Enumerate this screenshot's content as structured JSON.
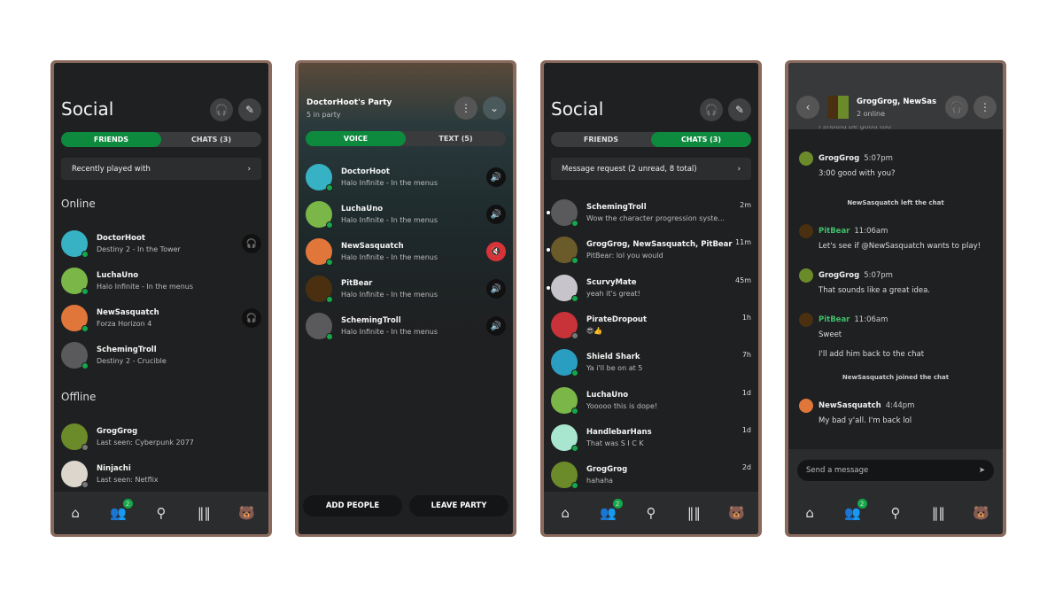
{
  "accent": "#0e8a3e",
  "online": "#14a84a",
  "muted": "#d9333a",
  "nav": {
    "icons": [
      "home-icon",
      "friends-icon",
      "search-icon",
      "library-icon",
      "profile-avatar-icon"
    ],
    "glyphs": [
      "⌂",
      "👥",
      "⚲",
      "‖‖",
      "🐻"
    ],
    "badge": "2"
  },
  "s1": {
    "title": "Social",
    "tabs": [
      "FRIENDS",
      "CHATS (3)"
    ],
    "recent": "Recently played with",
    "online_label": "Online",
    "offline_label": "Offline",
    "online": [
      {
        "name": "DoctorHoot",
        "status": "Destiny 2 - In the Tower",
        "color": "#37b2c4",
        "party": true
      },
      {
        "name": "LuchaUno",
        "status": "Halo Infinite - In the menus",
        "color": "#7ab648"
      },
      {
        "name": "NewSasquatch",
        "status": "Forza Horizon 4",
        "color": "#e0763a",
        "party": true
      },
      {
        "name": "SchemingTroll",
        "status": "Destiny 2 - Crucible",
        "color": "#5a5a5c"
      }
    ],
    "offline": [
      {
        "name": "GrogGrog",
        "status": "Last seen: Cyberpunk 2077",
        "color": "#6b8a2a"
      },
      {
        "name": "Ninjachi",
        "status": "Last seen: Netflix",
        "color": "#dcd6cc"
      }
    ]
  },
  "s2": {
    "title": "DoctorHoot's Party",
    "subtitle": "5 in party",
    "tabs": [
      "VOICE",
      "TEXT (5)"
    ],
    "members": [
      {
        "name": "DoctorHoot",
        "status": "Halo Infinite - In the menus",
        "color": "#37b2c4"
      },
      {
        "name": "LuchaUno",
        "status": "Halo Infinite - In the menus",
        "color": "#7ab648"
      },
      {
        "name": "NewSasquatch",
        "status": "Halo Infinite - In the menus",
        "color": "#e0763a",
        "muted": true
      },
      {
        "name": "PitBear",
        "status": "Halo Infinite - In the menus",
        "color": "#4a3010"
      },
      {
        "name": "SchemingTroll",
        "status": "Halo Infinite - In the menus",
        "color": "#5a5a5c"
      }
    ],
    "add": "ADD PEOPLE",
    "leave": "LEAVE PARTY"
  },
  "s3": {
    "title": "Social",
    "tabs": [
      "FRIENDS",
      "CHATS (3)"
    ],
    "request": "Message request (2 unread, 8 total)",
    "chats": [
      {
        "name": "SchemingTroll",
        "msg": "Wow the character progression syste...",
        "time": "2m",
        "color": "#5a5a5c",
        "unread": true
      },
      {
        "name": "GrogGrog, NewSasquatch, PitBear",
        "msg": "PitBear: lol you would",
        "time": "11m",
        "color": "#6b5a2a",
        "unread": true
      },
      {
        "name": "ScurvyMate",
        "msg": "yeah it's great!",
        "time": "45m",
        "color": "#c8c4cc",
        "unread": true
      },
      {
        "name": "PirateDropout",
        "msg": "😎👍",
        "time": "1h",
        "color": "#c8333a",
        "offline": true
      },
      {
        "name": "Shield Shark",
        "msg": "Ya i'll be on at 5",
        "time": "7h",
        "color": "#2a9ec0"
      },
      {
        "name": "LuchaUno",
        "msg": "Yooooo this is dope!",
        "time": "1d",
        "color": "#7ab648"
      },
      {
        "name": "HandlebarHans",
        "msg": "That was S I C K",
        "time": "1d",
        "color": "#a8e6d0"
      },
      {
        "name": "GrogGrog",
        "msg": "hahaha",
        "time": "2d",
        "color": "#6b8a2a"
      }
    ]
  },
  "s4": {
    "title": "GrogGrog, NewSasq...",
    "subtitle": "2 online",
    "cut": "I should be good too",
    "messages": [
      {
        "sender": "GrogGrog",
        "time": "5:07pm",
        "lines": [
          "3:00 good with you?"
        ],
        "color": "#6b8a2a"
      },
      {
        "system": "NewSasquatch left the chat"
      },
      {
        "sender": "PitBear",
        "time": "11:06am",
        "lines": [
          "Let's see if @NewSasquatch  wants to play!"
        ],
        "color": "#4a3010",
        "green": true
      },
      {
        "sender": "GrogGrog",
        "time": "5:07pm",
        "lines": [
          "That sounds like a great idea."
        ],
        "color": "#6b8a2a"
      },
      {
        "sender": "PitBear",
        "time": "11:06am",
        "lines": [
          "Sweet",
          "I'll add him back to the chat"
        ],
        "color": "#4a3010",
        "green": true
      },
      {
        "system": "NewSasquatch joined the chat"
      },
      {
        "sender": "NewSasquatch",
        "time": "4:44pm",
        "lines": [
          "My bad y'all. I'm back lol"
        ],
        "color": "#e0763a"
      }
    ],
    "placeholder": "Send a message"
  }
}
